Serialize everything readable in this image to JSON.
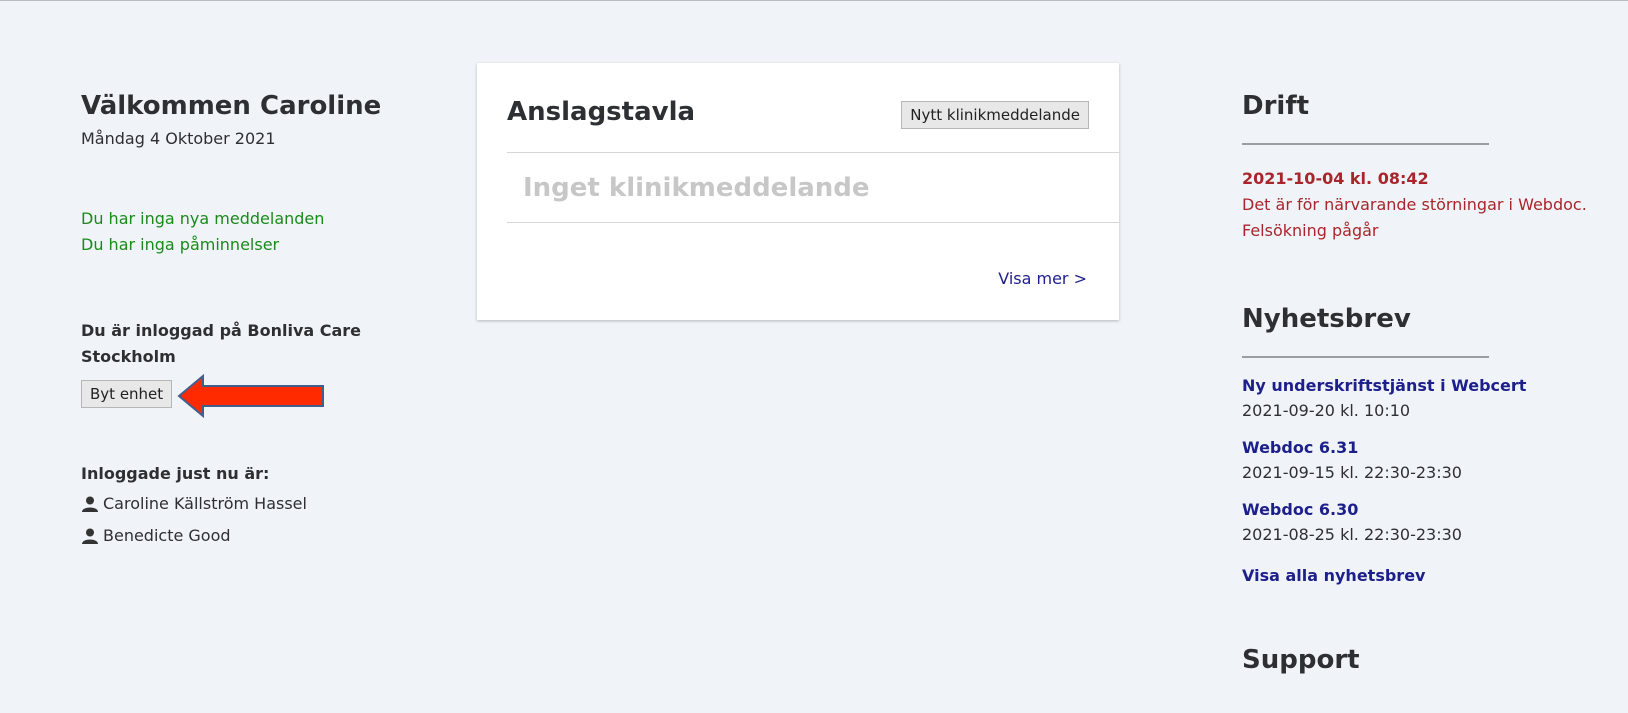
{
  "left": {
    "welcome": "Välkommen Caroline",
    "date": "Måndag 4 Oktober 2021",
    "messages_notice": "Du har inga nya meddelanden",
    "reminders_notice": "Du har inga påminnelser",
    "logged_in_unit": "Du är inloggad på Bonliva Care Stockholm",
    "switch_unit_label": "Byt enhet",
    "online_title": "Inloggade just nu är:",
    "online_users": [
      "Caroline Källström Hassel",
      "Benedicte Good"
    ],
    "icons": {
      "user": "user-icon",
      "arrow": "red-arrow-icon"
    },
    "colors": {
      "notice": "#1a8a1a",
      "arrow": "#ff2a00",
      "arrow_border": "#3f5f8f"
    }
  },
  "bulletin": {
    "title": "Anslagstavla",
    "new_message_label": "Nytt klinikmeddelande",
    "empty_text": "Inget klinikmeddelande",
    "show_more": "Visa mer >"
  },
  "right": {
    "drift": {
      "title": "Drift",
      "date": "2021-10-04 kl. 08:42",
      "text": "Det är för närvarande störningar i Webdoc. Felsökning pågår",
      "color": "#a8262b"
    },
    "newsletter": {
      "title": "Nyhetsbrev",
      "items": [
        {
          "title": "Ny underskriftstjänst i Webcert",
          "date": "2021-09-20 kl. 10:10"
        },
        {
          "title": "Webdoc 6.31",
          "date": "2021-09-15 kl. 22:30-23:30"
        },
        {
          "title": "Webdoc 6.30",
          "date": "2021-08-25 kl. 22:30-23:30"
        }
      ],
      "all_label": "Visa alla nyhetsbrev",
      "link_color": "#1d1f8a"
    },
    "support": {
      "title": "Support"
    }
  }
}
